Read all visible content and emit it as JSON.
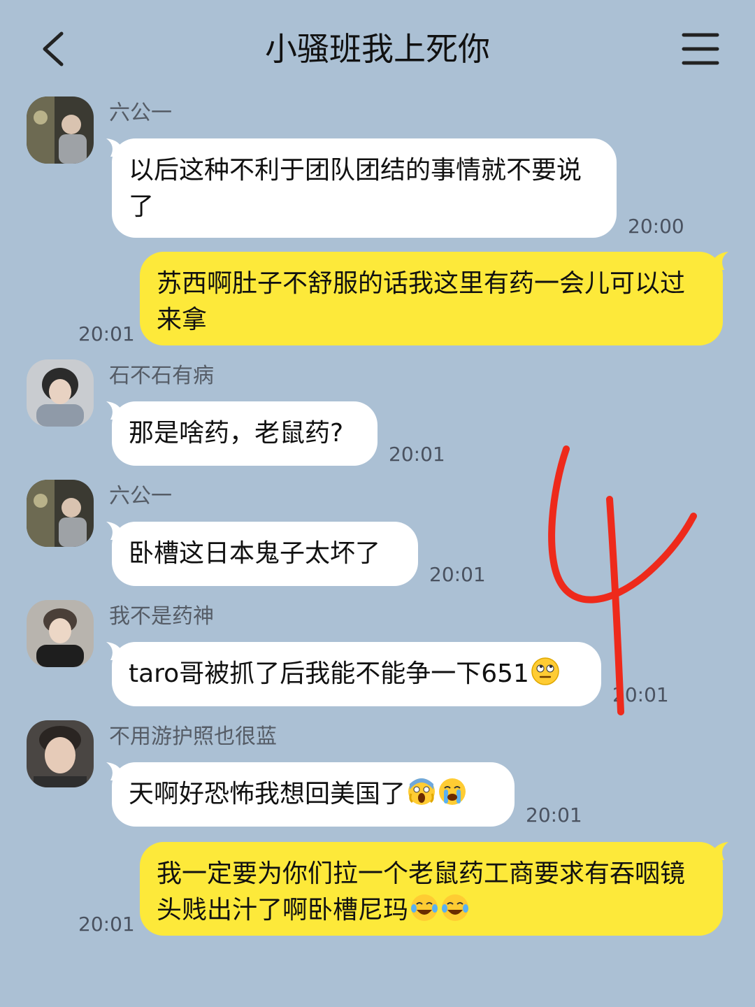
{
  "header": {
    "title": "小骚班我上死你",
    "back_icon": "chevron-left-icon",
    "menu_icon": "hamburger-menu-icon"
  },
  "messages": [
    {
      "side": "left",
      "sender": "六公一",
      "text": "以后这种不利于团队团结的事情就不要说了",
      "time": "20:00"
    },
    {
      "side": "right",
      "text": "苏西啊肚子不舒服的话我这里有药一会儿可以过来拿",
      "time": "20:01"
    },
    {
      "side": "left",
      "sender": "石不石有病",
      "text": "那是啥药，老鼠药?",
      "time": "20:01"
    },
    {
      "side": "left",
      "sender": "六公一",
      "text": "卧槽这日本鬼子太坏了",
      "time": "20:01"
    },
    {
      "side": "left",
      "sender": "我不是药神",
      "text": "taro哥被抓了后我能不能争一下651",
      "emoji": [
        "face-with-rolling-eyes-emoji"
      ],
      "time": "20:01"
    },
    {
      "side": "left",
      "sender": "不用游护照也很蓝",
      "text": "天啊好恐怖我想回美国了",
      "emoji": [
        "face-screaming-in-fear-emoji",
        "loudly-crying-face-emoji"
      ],
      "time": "20:01"
    },
    {
      "side": "right",
      "text": "我一定要为你们拉一个老鼠药工商要求有吞咽镜头贱出汁了啊卧槽尼玛",
      "emoji": [
        "face-with-tears-of-joy-emoji",
        "face-with-tears-of-joy-emoji"
      ],
      "time": "20:01"
    }
  ],
  "overlay": {
    "handwritten_mark": "4"
  },
  "colors": {
    "background": "#abc0d4",
    "incoming_bubble": "#ffffff",
    "outgoing_bubble": "#fde93a",
    "handwriting": "#ee2a1b"
  }
}
